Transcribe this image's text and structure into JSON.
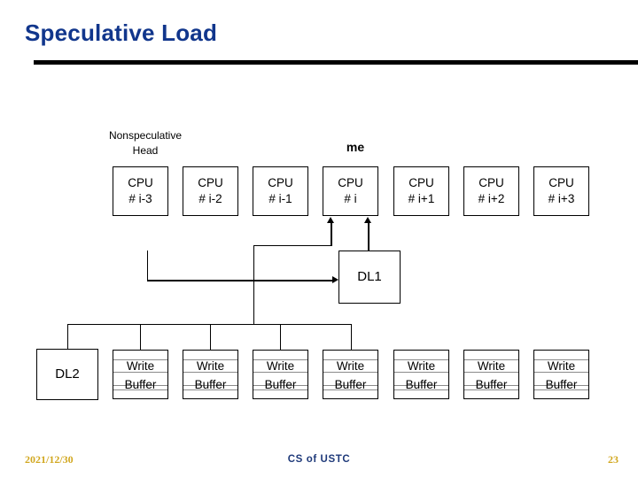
{
  "slide": {
    "title": "Speculative Load",
    "title_color": "#11368c"
  },
  "diagram": {
    "head_label_line1": "Nonspeculative",
    "head_label_line2": "Head",
    "me_label": "me",
    "cpus": [
      {
        "line1": "CPU",
        "line2": "# i-3"
      },
      {
        "line1": "CPU",
        "line2": "# i-2"
      },
      {
        "line1": "CPU",
        "line2": "# i-1"
      },
      {
        "line1": "CPU",
        "line2": "# i"
      },
      {
        "line1": "CPU",
        "line2": "# i+1"
      },
      {
        "line1": "CPU",
        "line2": "# i+2"
      },
      {
        "line1": "CPU",
        "line2": "# i+3"
      }
    ],
    "dl1_label": "DL1",
    "dl2_label": "DL2",
    "write_buffers": [
      {
        "line1": "Write",
        "line2": "Buffer"
      },
      {
        "line1": "Write",
        "line2": "Buffer"
      },
      {
        "line1": "Write",
        "line2": "Buffer"
      },
      {
        "line1": "Write",
        "line2": "Buffer"
      },
      {
        "line1": "Write",
        "line2": "Buffer"
      },
      {
        "line1": "Write",
        "line2": "Buffer"
      },
      {
        "line1": "Write",
        "line2": "Buffer"
      }
    ]
  },
  "footer": {
    "date": "2021/12/30",
    "center": "CS of USTC",
    "page": "23",
    "date_color": "#d2a821",
    "center_color": "#1f3a7a"
  }
}
